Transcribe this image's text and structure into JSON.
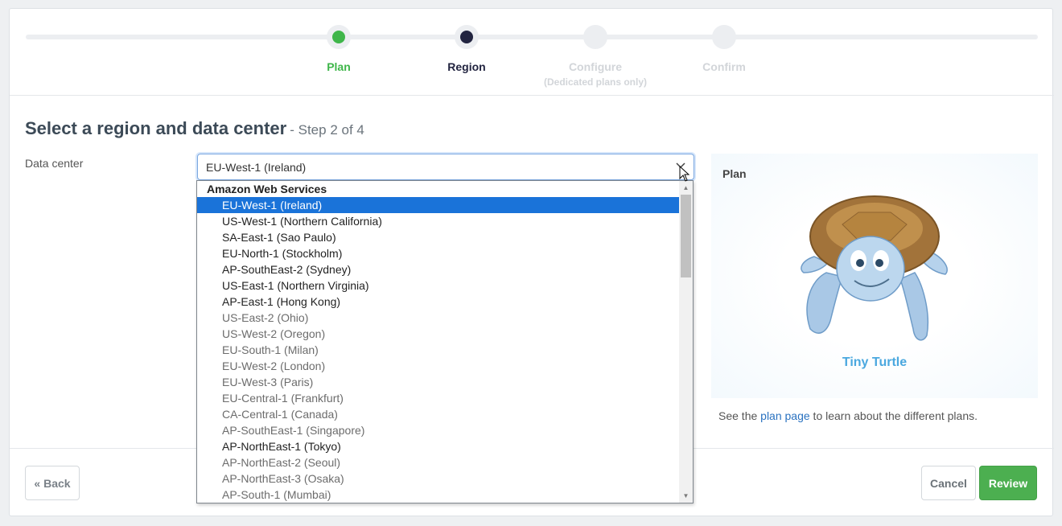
{
  "stepper": {
    "steps": [
      {
        "label": "Plan",
        "sub": "",
        "state": "done"
      },
      {
        "label": "Region",
        "sub": "",
        "state": "active"
      },
      {
        "label": "Configure",
        "sub": "(Dedicated plans only)",
        "state": "pending"
      },
      {
        "label": "Confirm",
        "sub": "",
        "state": "pending"
      }
    ]
  },
  "page": {
    "title": "Select a region and data center",
    "step_text": "- Step 2 of 4"
  },
  "form": {
    "data_center_label": "Data center",
    "selected_value": "EU-West-1 (Ireland)"
  },
  "dropdown": {
    "group": "Amazon Web Services",
    "items": [
      {
        "label": "EU-West-1 (Ireland)",
        "selected": true,
        "muted": false
      },
      {
        "label": "US-West-1 (Northern California)",
        "selected": false,
        "muted": false
      },
      {
        "label": "SA-East-1 (Sao Paulo)",
        "selected": false,
        "muted": false
      },
      {
        "label": "EU-North-1 (Stockholm)",
        "selected": false,
        "muted": false
      },
      {
        "label": "AP-SouthEast-2 (Sydney)",
        "selected": false,
        "muted": false
      },
      {
        "label": "US-East-1 (Northern Virginia)",
        "selected": false,
        "muted": false
      },
      {
        "label": "AP-East-1 (Hong Kong)",
        "selected": false,
        "muted": false
      },
      {
        "label": "US-East-2 (Ohio)",
        "selected": false,
        "muted": true
      },
      {
        "label": "US-West-2 (Oregon)",
        "selected": false,
        "muted": true
      },
      {
        "label": "EU-South-1 (Milan)",
        "selected": false,
        "muted": true
      },
      {
        "label": "EU-West-2 (London)",
        "selected": false,
        "muted": true
      },
      {
        "label": "EU-West-3 (Paris)",
        "selected": false,
        "muted": true
      },
      {
        "label": "EU-Central-1 (Frankfurt)",
        "selected": false,
        "muted": true
      },
      {
        "label": "CA-Central-1 (Canada)",
        "selected": false,
        "muted": true
      },
      {
        "label": "AP-SouthEast-1 (Singapore)",
        "selected": false,
        "muted": true
      },
      {
        "label": "AP-NorthEast-1 (Tokyo)",
        "selected": false,
        "muted": false
      },
      {
        "label": "AP-NorthEast-2 (Seoul)",
        "selected": false,
        "muted": true
      },
      {
        "label": "AP-NorthEast-3 (Osaka)",
        "selected": false,
        "muted": true
      },
      {
        "label": "AP-South-1 (Mumbai)",
        "selected": false,
        "muted": true
      }
    ]
  },
  "plan": {
    "heading": "Plan",
    "name": "Tiny Turtle",
    "note_prefix": "See the ",
    "note_link": "plan page",
    "note_suffix": " to learn about the different plans."
  },
  "footer": {
    "back_label": "« Back",
    "cancel_label": "Cancel",
    "review_label": "Review"
  },
  "colors": {
    "success": "#3fb64a",
    "active": "#222440",
    "accent": "#4aa8df",
    "selection": "#1a73d9",
    "review_button": "#4caf50"
  }
}
